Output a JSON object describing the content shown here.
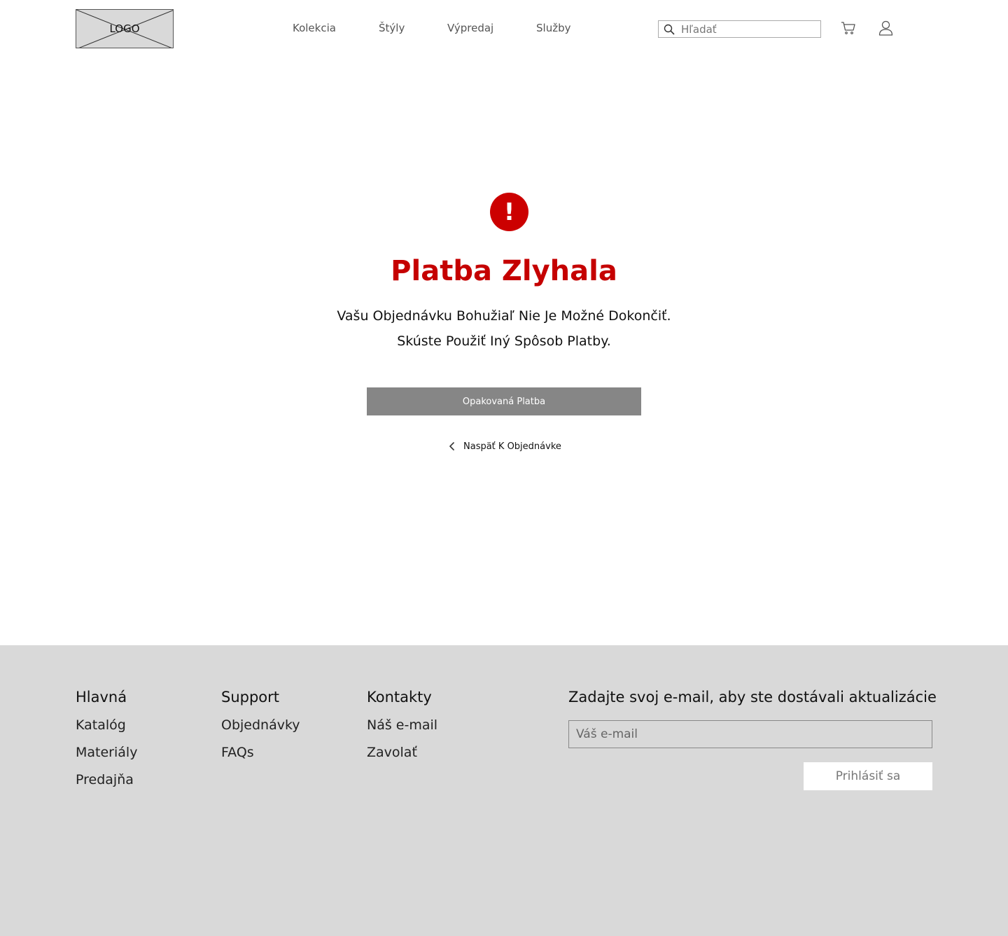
{
  "header": {
    "logo_text": "LOGO",
    "nav": [
      {
        "label": "Kolekcia"
      },
      {
        "label": "Štýly"
      },
      {
        "label": "Výpredaj"
      },
      {
        "label": "Služby"
      }
    ],
    "search_placeholder": "Hľadať",
    "icons": [
      "search-icon",
      "cart-icon",
      "user-icon"
    ]
  },
  "error": {
    "icon_symbol": "!",
    "title": "Platba Zlyhala",
    "message_line1": "Vašu Objednávku Bohužiaľ Nie Je Možné Dokončiť.",
    "message_line2": "Skúste Použiť Iný Spôsob Platby.",
    "retry_label": "Opakovaná Platba",
    "back_label": "Naspäť K Objednávke"
  },
  "footer": {
    "columns": [
      {
        "title": "Hlavná",
        "links": [
          "Katalóg",
          "Materiály",
          "Predajňa"
        ]
      },
      {
        "title": "Support",
        "links": [
          "Objednávky",
          "FAQs"
        ]
      },
      {
        "title": "Kontakty",
        "links": [
          "Náš e-mail",
          "Zavolať"
        ]
      }
    ],
    "newsletter_title": "Zadajte svoj e-mail, aby ste dostávali aktualizácie",
    "email_placeholder": "Váš e-mail",
    "subscribe_label": "Prihlásiť sa"
  },
  "colors": {
    "accent_error": "#cc0000",
    "button_grey": "#868686",
    "footer_bg": "#d9d9d9"
  }
}
